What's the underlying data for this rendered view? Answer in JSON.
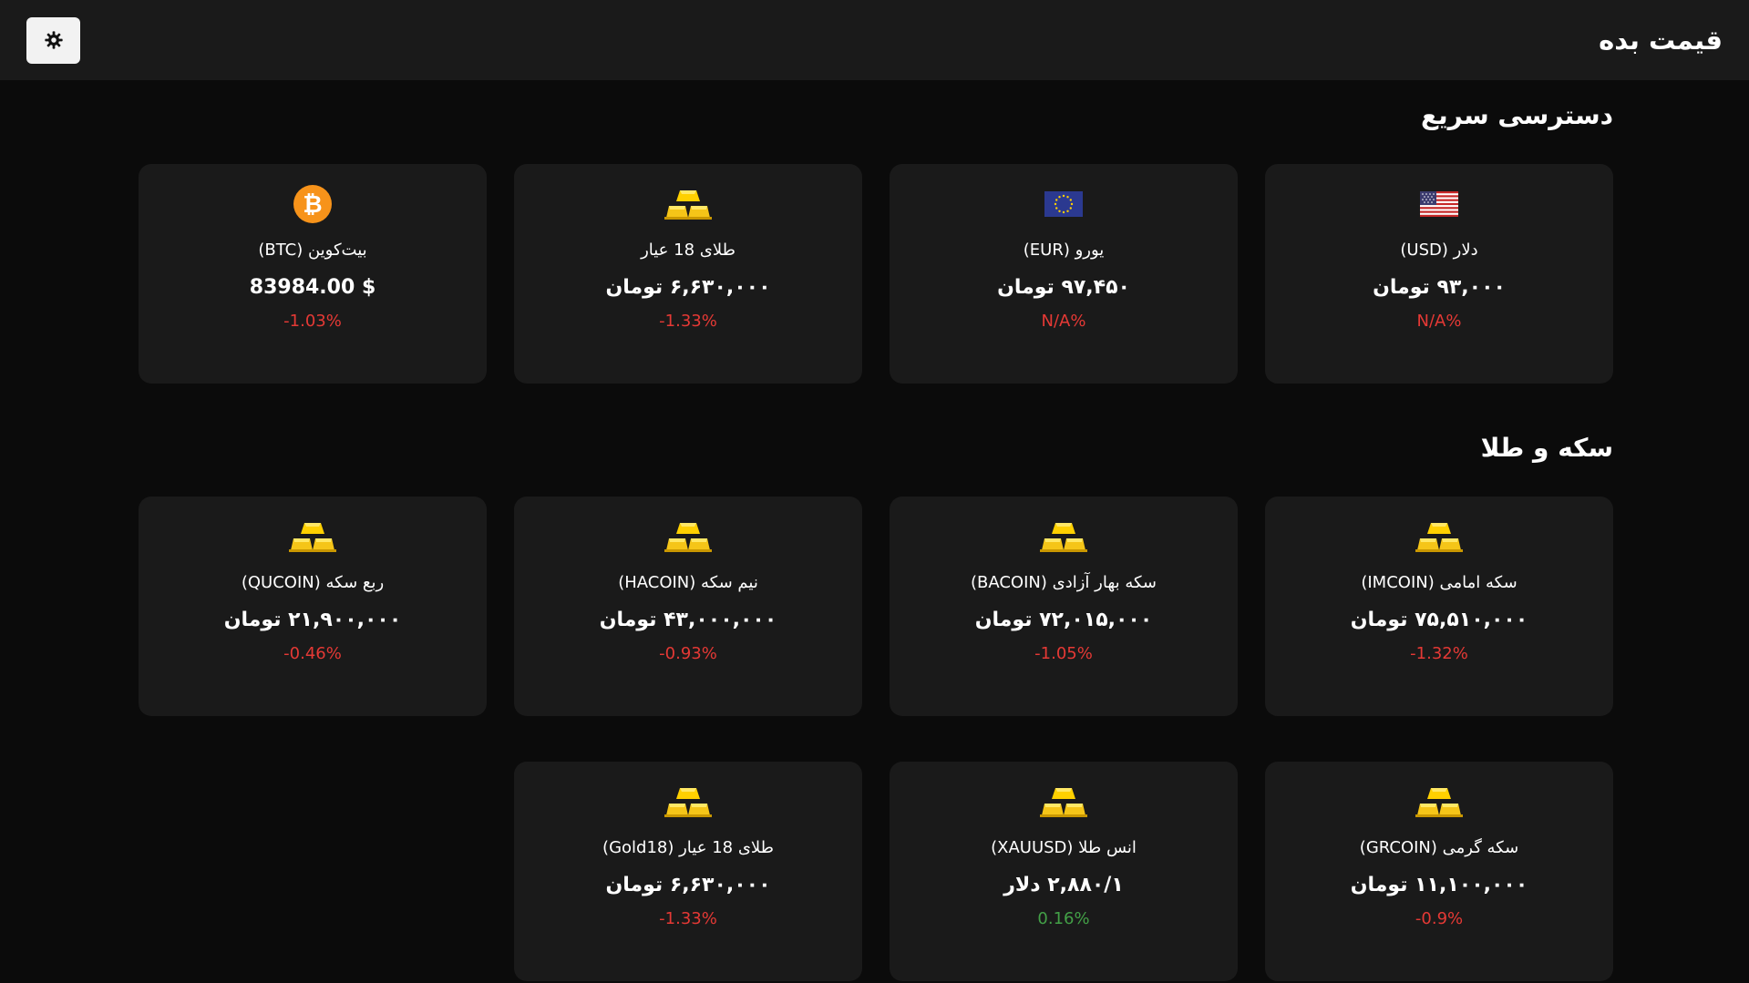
{
  "header": {
    "title": "قیمت بده",
    "theme_icon": "gear-icon"
  },
  "colors": {
    "negative": "#e53935",
    "positive": "#43a047",
    "card_bg": "#1a1a1a",
    "gold": "#f5c518",
    "bitcoin": "#f7931a"
  },
  "quick_access": {
    "title": "دسترسی سریع",
    "cards": [
      {
        "icon": "usa-flag-icon",
        "name": "دلار (USD)",
        "price": "۹۳,۰۰۰ تومان",
        "change": "%N/A",
        "trend": "neg"
      },
      {
        "icon": "eu-flag-icon",
        "name": "یورو (EUR)",
        "price": "۹۷,۴۵۰ تومان",
        "change": "%N/A",
        "trend": "neg"
      },
      {
        "icon": "gold-bars-icon",
        "name": "طلای 18 عیار",
        "price": "۶,۶۳۰,۰۰۰ تومان",
        "change": "1.33%-",
        "trend": "neg"
      },
      {
        "icon": "bitcoin-icon",
        "name": "بیت‌کوین (BTC)",
        "price": "$ 83984.00",
        "change": "1.03%-",
        "trend": "neg"
      }
    ]
  },
  "coin_gold": {
    "title": "سکه و طلا",
    "cards": [
      {
        "icon": "gold-bars-icon",
        "name": "سکه امامی (IMCOIN)",
        "price": "۷۵,۵۱۰,۰۰۰ تومان",
        "change": "1.32%-",
        "trend": "neg"
      },
      {
        "icon": "gold-bars-icon",
        "name": "سکه بهار آزادی (BACOIN)",
        "price": "۷۲,۰۱۵,۰۰۰ تومان",
        "change": "1.05%-",
        "trend": "neg"
      },
      {
        "icon": "gold-bars-icon",
        "name": "نیم سکه (HACOIN)",
        "price": "۴۳,۰۰۰,۰۰۰ تومان",
        "change": "0.93%-",
        "trend": "neg"
      },
      {
        "icon": "gold-bars-icon",
        "name": "ربع سکه (QUCOIN)",
        "price": "۲۱,۹۰۰,۰۰۰ تومان",
        "change": "0.46%-",
        "trend": "neg"
      },
      {
        "icon": "gold-bars-icon",
        "name": "سکه گرمی (GRCOIN)",
        "price": "۱۱,۱۰۰,۰۰۰ تومان",
        "change": "0.9%-",
        "trend": "neg"
      },
      {
        "icon": "gold-bars-icon",
        "name": "انس طلا (XAUUSD)",
        "price": "۲,۸۸۰/۱ دلار",
        "change": "0.16%",
        "trend": "pos"
      },
      {
        "icon": "gold-bars-icon",
        "name": "طلای 18 عیار (Gold18)",
        "price": "۶,۶۳۰,۰۰۰ تومان",
        "change": "1.33%-",
        "trend": "neg"
      }
    ]
  }
}
